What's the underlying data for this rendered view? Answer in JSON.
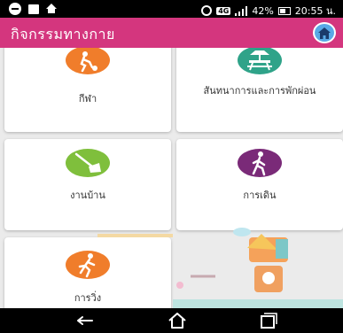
{
  "status_bar": {
    "network_badge": "4G",
    "battery_percent": "42%",
    "time": "20:55 น."
  },
  "app": {
    "title": "กิจกรรมทางกาย",
    "colors": {
      "header": "#d4367e",
      "home_button": "#5aa9e6"
    }
  },
  "cards": [
    {
      "label": "กีฬา",
      "icon": "soccer-icon",
      "icon_color": "#f07d2b"
    },
    {
      "label": "สันทนาการและการพักผ่อน",
      "icon": "picnic-table-icon",
      "icon_color": "#2fa389"
    },
    {
      "label": "งานบ้าน",
      "icon": "broom-icon",
      "icon_color": "#7fbf3c"
    },
    {
      "label": "การเดิน",
      "icon": "walking-icon",
      "icon_color": "#7a2a78"
    },
    {
      "label": "การวิ่ง",
      "icon": "running-icon",
      "icon_color": "#f07d2b"
    }
  ],
  "nav_bar": {
    "back": "back-icon",
    "home": "home-icon",
    "recents": "recent-apps-icon"
  }
}
